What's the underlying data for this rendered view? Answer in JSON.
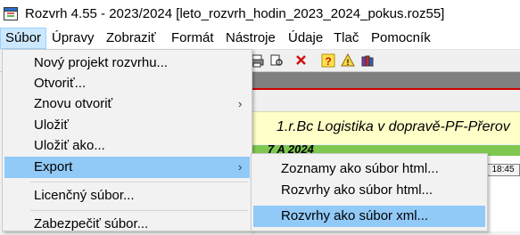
{
  "window": {
    "title": "Rozvrh 4.55 - 2023/2024 [leto_rozvrh_hodin_2023_2024_pokus.roz55]",
    "icon": "calendar-app-icon"
  },
  "menubar": {
    "items": [
      "Súbor",
      "Úpravy",
      "Zobraziť",
      "Formát",
      "Nástroje",
      "Údaje",
      "Tlač",
      "Pomocník"
    ],
    "active": "Súbor"
  },
  "file_menu": {
    "items": [
      {
        "label": "Nový projekt rozvrhu..."
      },
      {
        "label": "Otvoriť..."
      },
      {
        "label": "Znovu otvoriť",
        "submenu_arrow": "›"
      },
      {
        "label": "Uložiť"
      },
      {
        "label": "Uložiť ako..."
      },
      {
        "label": "Export",
        "submenu_arrow": "›"
      },
      {
        "label": "Licenčný súbor..."
      },
      {
        "label": "Zabezpečiť súbor..."
      }
    ],
    "highlighted": "Export"
  },
  "export_submenu": {
    "items": [
      {
        "label": "Zoznamy ako súbor html..."
      },
      {
        "label": "Rozvrhy ako súbor html..."
      },
      {
        "label": "Rozvrhy ako súbor xml..."
      }
    ],
    "highlighted": "Rozvrhy ako súbor xml..."
  },
  "background": {
    "schedule_title": "1.r.Bc Logistika v dopravě-PF-Přerov",
    "group_code": "7 A 2024",
    "time_cell": "18:45"
  },
  "colors": {
    "highlight": "#91c9f7",
    "menubar_active": "#cce8ff",
    "schedule_band": "#ffffc8",
    "green_band": "#7ec850"
  }
}
